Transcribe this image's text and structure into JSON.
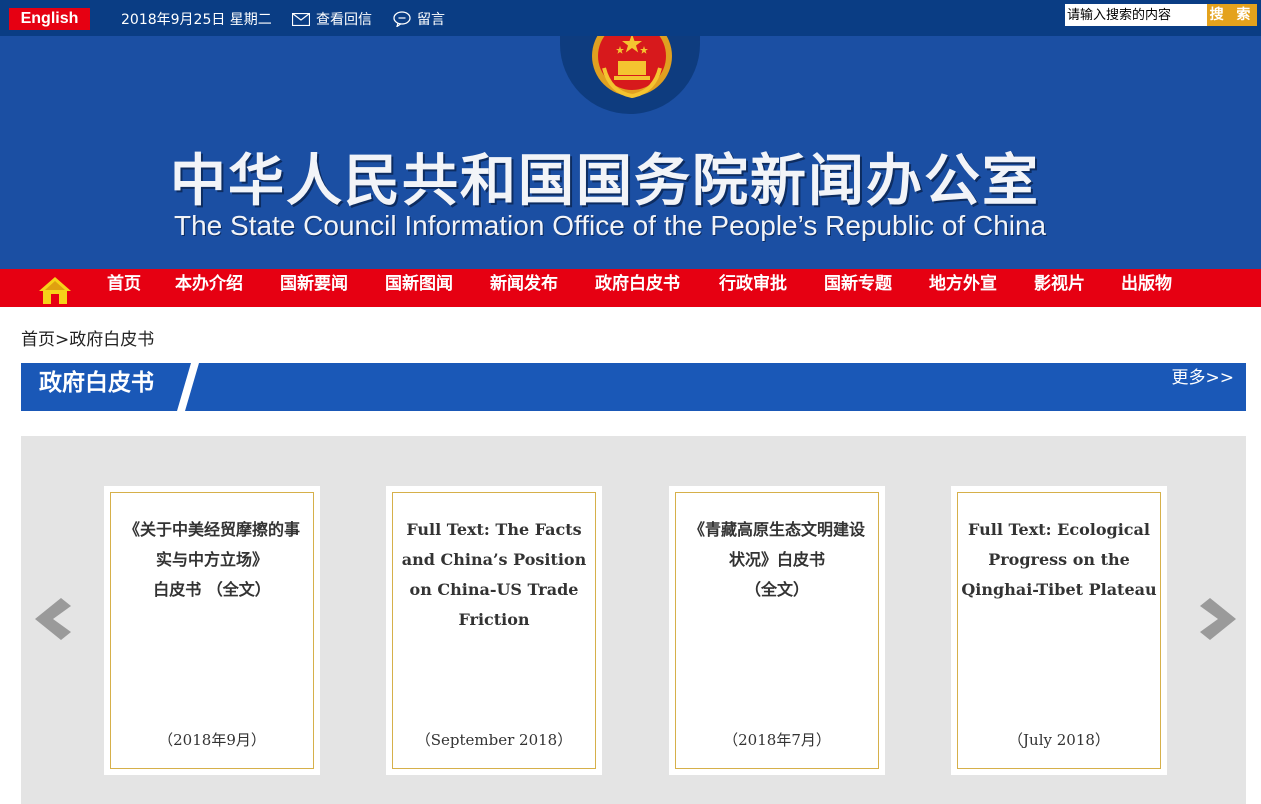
{
  "topbar": {
    "english_label": "English",
    "date": "2018年9月25日 星期二",
    "mail_label": "查看回信",
    "message_label": "留言",
    "search_placeholder": "请输入搜索的内容",
    "search_button": "搜 索"
  },
  "banner": {
    "title_cn": "中华人民共和国国务院新闻办公室",
    "title_en": "The State Council Information Office of the People’s Republic of China"
  },
  "nav": {
    "items": [
      "首页",
      "本办介绍",
      "国新要闻",
      "国新图闻",
      "新闻发布",
      "政府白皮书",
      "行政审批",
      "国新专题",
      "地方外宣",
      "影视片",
      "出版物"
    ]
  },
  "breadcrumb": {
    "home": "首页",
    "separator": ">",
    "current": "政府白皮书"
  },
  "section": {
    "title": "政府白皮书",
    "more": "更多>>"
  },
  "cards": [
    {
      "lines": [
        "《关于中美经贸摩擦的事",
        "实与中方立场》",
        "白皮书 （全文）"
      ],
      "date": "（2018年9月）"
    },
    {
      "lines": [
        "Full Text: The Facts",
        "and China’s Position",
        "on China-US Trade",
        "Friction"
      ],
      "date": "（September 2018）"
    },
    {
      "lines": [
        "《青藏高原生态文明建设",
        "状况》白皮书",
        "（全文）"
      ],
      "date": "（2018年7月）"
    },
    {
      "lines": [
        "Full Text: Ecological",
        "Progress on the",
        "Qinghai-Tibet Plateau"
      ],
      "date": "（July 2018）"
    }
  ],
  "colors": {
    "topbar": "#0a3d84",
    "banner": "#1b4fa3",
    "nav": "#e60012",
    "section": "#1a58b7",
    "search_button": "#e4a21c",
    "card_border": "#d6b04a"
  },
  "icons": {
    "mail": "envelope-icon",
    "message": "speech-bubble-icon",
    "home": "house-icon",
    "emblem": "national-emblem",
    "prev": "chevron-left-icon",
    "next": "chevron-right-icon"
  }
}
